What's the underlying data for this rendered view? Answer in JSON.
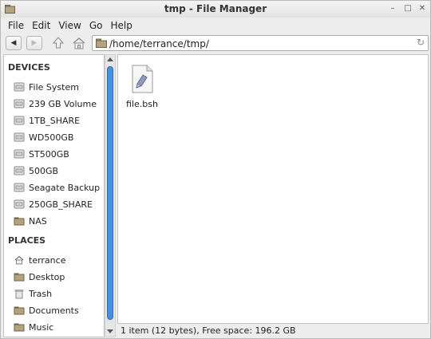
{
  "window": {
    "title": "tmp - File Manager",
    "buttons": {
      "minimize": "–",
      "maximize": "□",
      "close": "✕"
    }
  },
  "menubar": {
    "items": [
      "File",
      "Edit",
      "View",
      "Go",
      "Help"
    ]
  },
  "toolbar": {
    "back": "◀",
    "forward": "▶",
    "location": "/home/terrance/tmp/",
    "reload": "↻"
  },
  "sidepane": {
    "devices_heading": "DEVICES",
    "devices": [
      "File System",
      "239 GB Volume",
      "1TB_SHARE",
      "WD500GB",
      "ST500GB",
      "500GB",
      "Seagate Backup ...",
      "250GB_SHARE",
      "NAS"
    ],
    "places_heading": "PLACES",
    "places": [
      "terrance",
      "Desktop",
      "Trash",
      "Documents",
      "Music"
    ]
  },
  "main": {
    "files": [
      {
        "name": "file.bsh",
        "icon": "script-file-icon"
      }
    ]
  },
  "status": {
    "text": "1 item (12 bytes), Free space: 196.2 GB"
  },
  "colors": {
    "accent": "#4a90d9",
    "folder": "#8a7a5a"
  }
}
